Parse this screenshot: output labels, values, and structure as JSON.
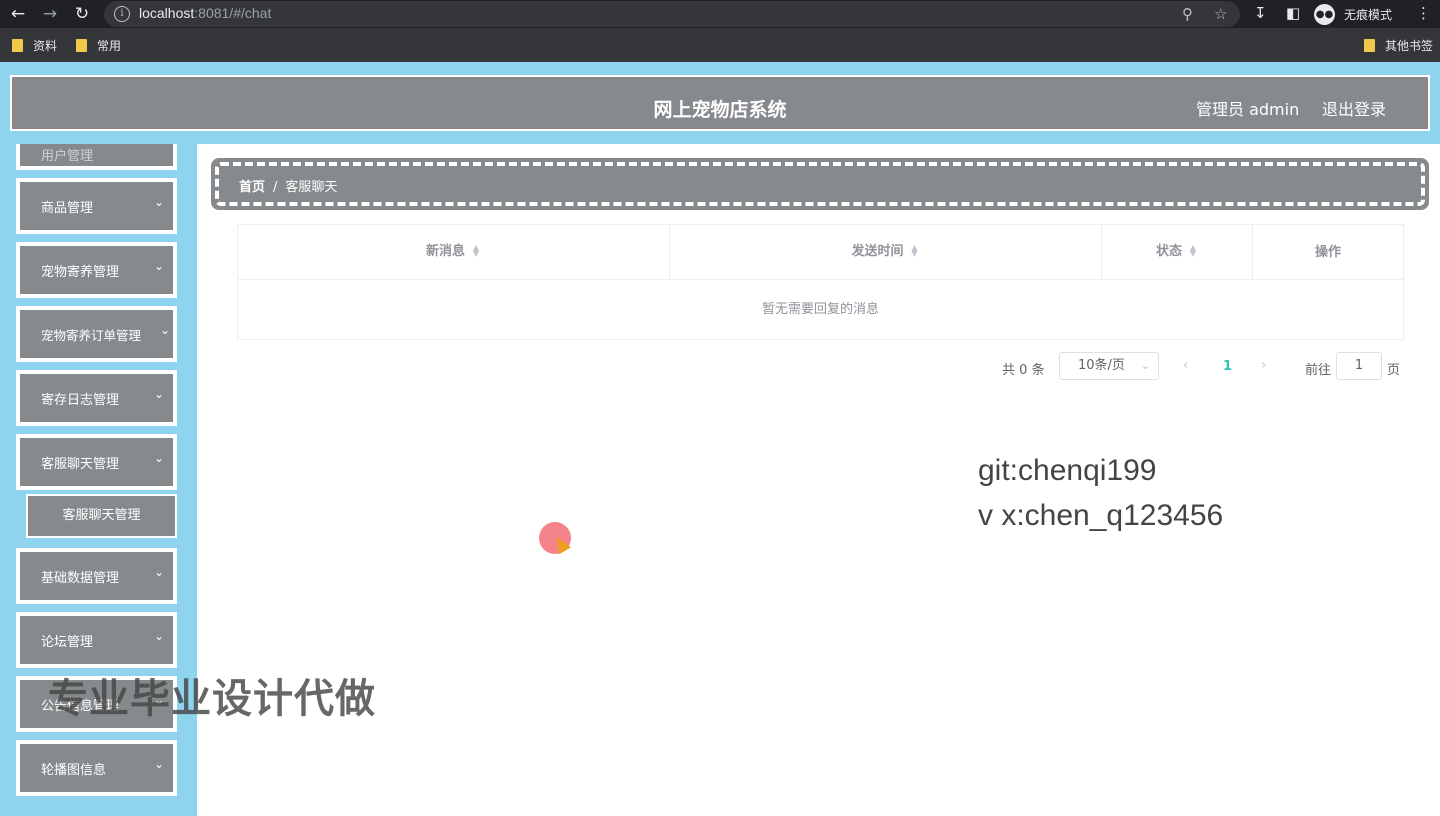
{
  "browser": {
    "url_host": "localhost",
    "url_rest": ":8081/#/chat",
    "incognito_label": "无痕模式",
    "bookmarks": [
      "资料",
      "常用"
    ],
    "other_bookmarks": "其他书签"
  },
  "header": {
    "title": "网上宠物店系统",
    "user": "管理员 admin",
    "logout": "退出登录"
  },
  "sidebar": {
    "partial_item": "用户管理",
    "items": [
      {
        "label": "商品管理"
      },
      {
        "label": "宠物寄养管理"
      },
      {
        "label": "宠物寄养订单管理"
      },
      {
        "label": "寄存日志管理"
      },
      {
        "label": "客服聊天管理"
      },
      {
        "label": "基础数据管理"
      },
      {
        "label": "论坛管理"
      },
      {
        "label": "公告信息管理"
      },
      {
        "label": "轮播图信息"
      }
    ],
    "active_sub": "客服聊天管理"
  },
  "breadcrumb": {
    "home": "首页",
    "separator": "/",
    "current": "客服聊天"
  },
  "table": {
    "columns": [
      "新消息",
      "发送时间",
      "状态",
      "操作"
    ],
    "empty_text": "暂无需要回复的消息"
  },
  "pagination": {
    "total": "共 0 条",
    "page_size": "10条/页",
    "current_page": "1",
    "goto_label": "前往",
    "goto_value": "1",
    "page_suffix": "页"
  },
  "overlay": {
    "git": "git:chenqi199",
    "vx": "v x:chen_q123456",
    "promo": "专业毕业设计代做"
  },
  "colors": {
    "sidebar_bg": "#8ed4ee",
    "menu_bg": "#868a8d",
    "active_page": "#2ec4b6"
  }
}
